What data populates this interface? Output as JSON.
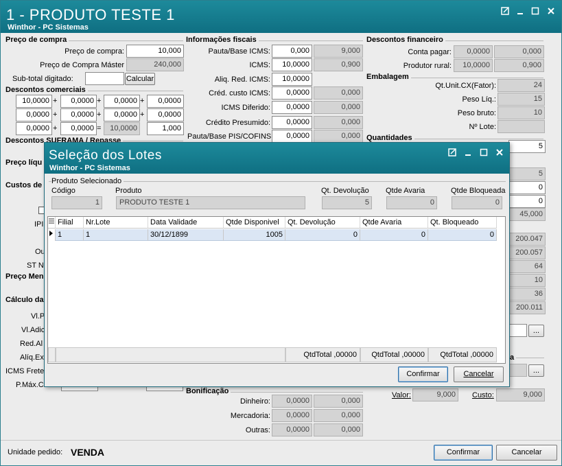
{
  "window": {
    "title": "1 - PRODUTO TESTE 1",
    "subtitle": "Winthor - PC Sistemas"
  },
  "preco_compra": {
    "section": "Preço de compra",
    "preco_label": "Preço de compra:",
    "preco_value": "10,000",
    "master_label": "Preço de Compra Máster",
    "master_value": "240,000",
    "subtotal_label": "Sub-total digitado:",
    "subtotal_value": "",
    "calcular": "Calcular"
  },
  "descontos_comerciais": {
    "section": "Descontos comerciais",
    "rows": [
      [
        "10,0000",
        "0,0000",
        "0,0000",
        "0,0000"
      ],
      [
        "0,0000",
        "0,0000",
        "0,0000",
        "0,0000"
      ],
      [
        "0,0000",
        "0,0000",
        "10,0000",
        "1,000"
      ]
    ],
    "ops": [
      [
        "+",
        "+",
        "+"
      ],
      [
        "+",
        "+",
        "+"
      ],
      [
        "+",
        "=",
        ""
      ]
    ]
  },
  "left_partial": {
    "suframa": "Descontos SUFRAMA / Repasse",
    "preco_liq": "Preço líqu",
    "custos": "Custos de",
    "ipi": "IPI",
    "ou": "Ou",
    "st": "ST NF",
    "preco_men": "Preço Men",
    "calculo": "Cálculo da",
    "vlp": "Vl.P",
    "vladic": "Vl.Adic",
    "redal": "Red.Al",
    "aliqext": "Alíq.Ext",
    "icms_frete": "ICMS Frete",
    "pmax": "P.Máx.C"
  },
  "info_fiscais": {
    "section": "Informações fiscais",
    "rows": [
      {
        "label": "Pauta/Base ICMS:",
        "value": "0,000",
        "ro": "9,000"
      },
      {
        "label": "ICMS:",
        "value": "10,0000",
        "ro": "0,900"
      },
      {
        "label": "Aliq. Red. ICMS:",
        "value": "10,0000",
        "ro": ""
      },
      {
        "label": "Créd. custo ICMS:",
        "value": "0,0000",
        "ro": "0,000"
      },
      {
        "label": "ICMS Diferido:",
        "value": "0,0000",
        "ro": "0,000"
      },
      {
        "label": "Crédito Presumido:",
        "value": "0,0000",
        "ro": "0,000"
      },
      {
        "label": "Pauta/Base PIS/COFINS:",
        "value": "0,0000",
        "ro": "0,000"
      }
    ]
  },
  "bonificacao": {
    "section": "Bonificação",
    "rows": [
      {
        "label": "Dinheiro:",
        "a": "0,0000",
        "b": "0,000"
      },
      {
        "label": "Mercadoria:",
        "a": "0,0000",
        "b": "0,000"
      },
      {
        "label": "Outras:",
        "a": "0,0000",
        "b": "0,000"
      }
    ]
  },
  "descontos_financeiro": {
    "section": "Descontos financeiro",
    "conta_label": "Conta pagar:",
    "conta_a": "0,0000",
    "conta_b": "0,000",
    "rural_label": "Produtor rural:",
    "rural_a": "10,0000",
    "rural_b": "0,900"
  },
  "embalagem": {
    "section": "Embalagem",
    "rows": [
      {
        "label": "Qt.Unit.CX(Fator):",
        "value": "24"
      },
      {
        "label": "Peso Líq.:",
        "value": "15"
      },
      {
        "label": "Peso bruto:",
        "value": "10"
      },
      {
        "label": "Nº Lote:",
        "value": ""
      }
    ]
  },
  "quantidades": {
    "section": "Quantidades",
    "value": "5",
    "right_values": [
      "5",
      "0",
      "0",
      "45,000",
      "200.047",
      "200.057",
      "64",
      "10",
      "36",
      "200.011"
    ]
  },
  "right_bottom": {
    "valor_label": "Valor:",
    "valor_value": "9,000",
    "custo_label": "Custo:",
    "custo_value": "9,000",
    "ellipsis": "...",
    "partial_a": "a"
  },
  "footer": {
    "unidade_label": "Unidade pedido:",
    "unidade_value": "VENDA",
    "confirmar": "Confirmar",
    "cancelar": "Cancelar"
  },
  "dialog": {
    "title": "Seleção dos Lotes",
    "subtitle": "Winthor - PC Sistemas",
    "group": "Produto Selecionado",
    "codigo_label": "Código",
    "codigo_value": "1",
    "produto_label": "Produto",
    "produto_value": "PRODUTO TESTE 1",
    "qtdev_label": "Qt. Devolução",
    "qtdev_value": "5",
    "avaria_label": "Qtde Avaria",
    "avaria_value": "0",
    "bloq_label": "Qtde Bloqueada",
    "bloq_value": "0",
    "columns": [
      "Filial",
      "Nr.Lote",
      "Data Validade",
      "Qtde Disponivel",
      "Qt. Devolução",
      "Qtde Avaria",
      "Qt. Bloqueado"
    ],
    "rows": [
      [
        "1",
        "1",
        "30/12/1899",
        "1005",
        "0",
        "0",
        "0"
      ]
    ],
    "totals": [
      "QtdTotal  ,00000",
      "QtdTotal  ,00000",
      "QtdTotal  ,00000"
    ],
    "confirmar": "Confirmar",
    "cancelar": "Cancelar"
  }
}
